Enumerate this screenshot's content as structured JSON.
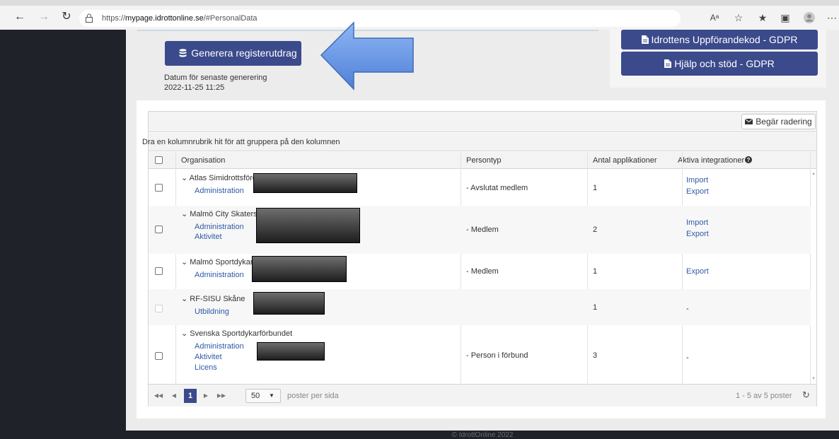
{
  "browser": {
    "url_prefix": "https://",
    "url_host": "mypage.idrottonline.se",
    "url_path": "/#PersonalData",
    "reader_icon": "Aᵃ",
    "icons": [
      "back-icon",
      "forward-icon",
      "refresh-icon",
      "lock-icon",
      "read-aloud-icon",
      "favorite-add-icon",
      "favorites-icon",
      "collections-icon",
      "profile-icon",
      "more-icon"
    ]
  },
  "generate": {
    "button_label": "Generera registerutdrag",
    "date_label": "Datum för senaste generering",
    "date_value": "2022-11-25 11:25"
  },
  "side_buttons": {
    "conduct_label": "Idrottens Uppförandekod - GDPR",
    "help_label": "Hjälp och stöd - GDPR"
  },
  "grid": {
    "request_delete_label": "Begär radering",
    "group_hint": "Dra en kolumnrubrik hit för att gruppera på den kolumnen",
    "columns": {
      "organisation": "Organisation",
      "persontyp": "Persontyp",
      "apps": "Antal applikationer",
      "integrations": "Aktiva integrationer"
    },
    "rows": [
      {
        "org": "Atlas Simidrottsföre",
        "subs": [
          "Administration"
        ],
        "persontyp": "- Avslutat medlem",
        "apps": "1",
        "integrations": [
          "Import",
          "Export"
        ]
      },
      {
        "org": "Malmö City Skaters",
        "subs": [
          "Administration",
          "Aktivitet"
        ],
        "persontyp": "- Medlem",
        "apps": "2",
        "integrations": [
          "Import",
          "Export"
        ]
      },
      {
        "org": "Malmö Sportdykark",
        "subs": [
          "Administration"
        ],
        "persontyp": "- Medlem",
        "apps": "1",
        "integrations": [
          "Export"
        ]
      },
      {
        "org": "RF-SISU Skåne",
        "subs": [
          "Utbildning"
        ],
        "persontyp": "",
        "apps": "1",
        "integrations_text": "-"
      },
      {
        "org": "Svenska Sportdykarförbundet",
        "subs": [
          "Administration",
          "Aktivitet",
          "Licens"
        ],
        "persontyp": "- Person i förbund",
        "apps": "3",
        "integrations_text": "-"
      }
    ],
    "pager": {
      "current_page": "1",
      "page_size": "50",
      "page_size_label": "poster per sida",
      "info": "1 - 5 av 5 poster"
    }
  },
  "footer": "© IdrottOnline 2022",
  "colors": {
    "primary_button": "#3b4a8b",
    "link": "#2f5aa5",
    "arrow": "#6f9be6"
  }
}
